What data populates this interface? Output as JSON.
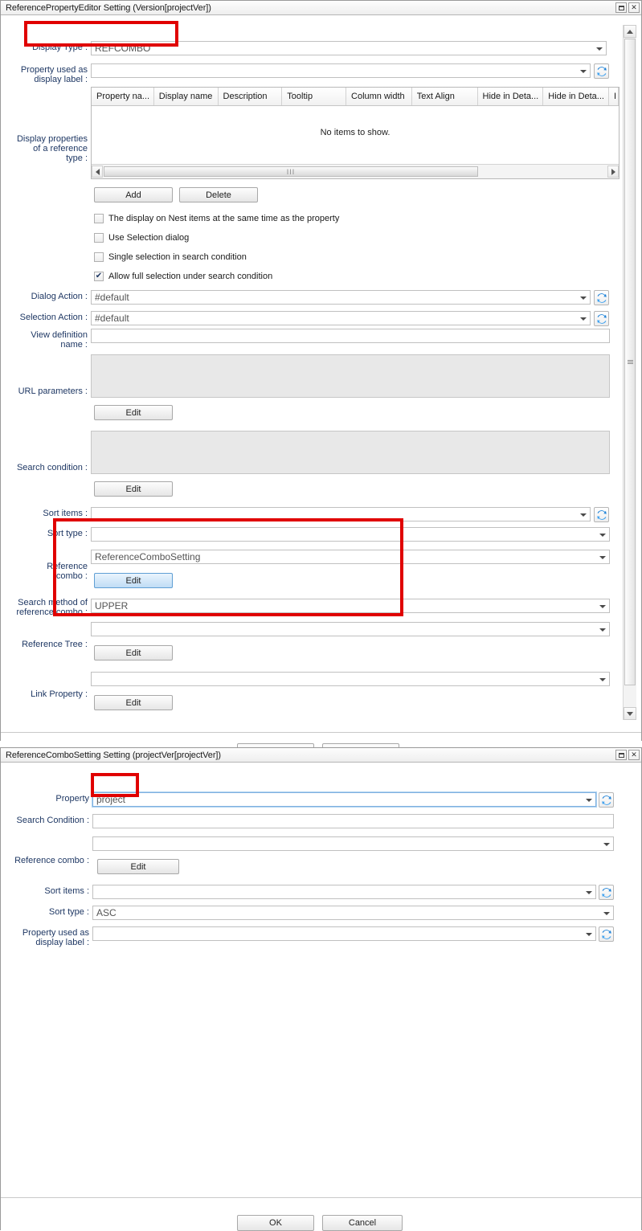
{
  "dialog1": {
    "title": "ReferencePropertyEditor Setting (Version[projectVer])",
    "minimize_label": "minimize",
    "close_label": "✕",
    "fields": {
      "display_type_label": "Display Type :",
      "display_type_value": "REFCOMBO",
      "prop_display_label": "Property used as\ndisplay label :",
      "prop_display_value": "",
      "display_props_label": "Display properties\nof a reference\ntype :",
      "dialog_action_label": "Dialog Action :",
      "dialog_action_value": "#default",
      "selection_action_label": "Selection Action :",
      "selection_action_value": "#default",
      "view_definition_label": "View definition\nname :",
      "view_definition_value": "",
      "url_parameters_label": "URL parameters :",
      "url_parameters_value": "",
      "search_condition_label": "Search condition :",
      "search_condition_value": "",
      "sort_items_label": "Sort items :",
      "sort_items_value": "",
      "sort_type_label": "Sort type :",
      "sort_type_value": "",
      "reference_combo_label": "Reference\ncombo :",
      "reference_combo_value": "ReferenceComboSetting",
      "search_method_label": "Search method of\nreference combo :",
      "search_method_value": "UPPER",
      "reference_tree_label": "Reference Tree :",
      "reference_tree_value": "",
      "link_property_label": "Link Property :",
      "link_property_value": ""
    },
    "table": {
      "columns": [
        "Property na...",
        "Display name",
        "Description",
        "Tooltip",
        "Column width",
        "Text Align",
        "Hide in Deta...",
        "Hide in Deta...",
        "I"
      ],
      "empty_message": "No items to show."
    },
    "buttons": {
      "add": "Add",
      "delete": "Delete",
      "edit_url": "Edit",
      "edit_search": "Edit",
      "edit_refcombo": "Edit",
      "edit_reftree": "Edit",
      "edit_linkprop": "Edit"
    },
    "checkboxes": [
      {
        "label": "The display on Nest items at the same time as the property",
        "checked": false,
        "mark": ""
      },
      {
        "label": "Use Selection dialog",
        "checked": false,
        "mark": ""
      },
      {
        "label": "Single selection in search condition",
        "checked": false,
        "mark": ""
      },
      {
        "label": "Allow full selection under search condition",
        "checked": true,
        "mark": "✔"
      }
    ]
  },
  "dialog2": {
    "title": "ReferenceComboSetting Setting (projectVer[projectVer])",
    "minimize_label": "minimize",
    "close_label": "✕",
    "fields": {
      "property_label": "Property",
      "property_value": "project",
      "search_condition_label": "Search Condition :",
      "search_condition_value": "",
      "reference_combo_label": "Reference combo :",
      "reference_combo_value": "",
      "sort_items_label": "Sort items :",
      "sort_items_value": "",
      "sort_type_label": "Sort type :",
      "sort_type_value": "ASC",
      "prop_display_label": "Property used as\ndisplay label :",
      "prop_display_value": ""
    },
    "buttons": {
      "edit_refcombo": "Edit",
      "ok": "OK",
      "cancel": "Cancel"
    }
  },
  "icons": {
    "refresh": "refresh-icon",
    "dropdown": "chevron-down-icon"
  },
  "colors": {
    "accent_red": "#e00000",
    "label_blue": "#1f3864",
    "button_blue": "#5f9fd4"
  }
}
